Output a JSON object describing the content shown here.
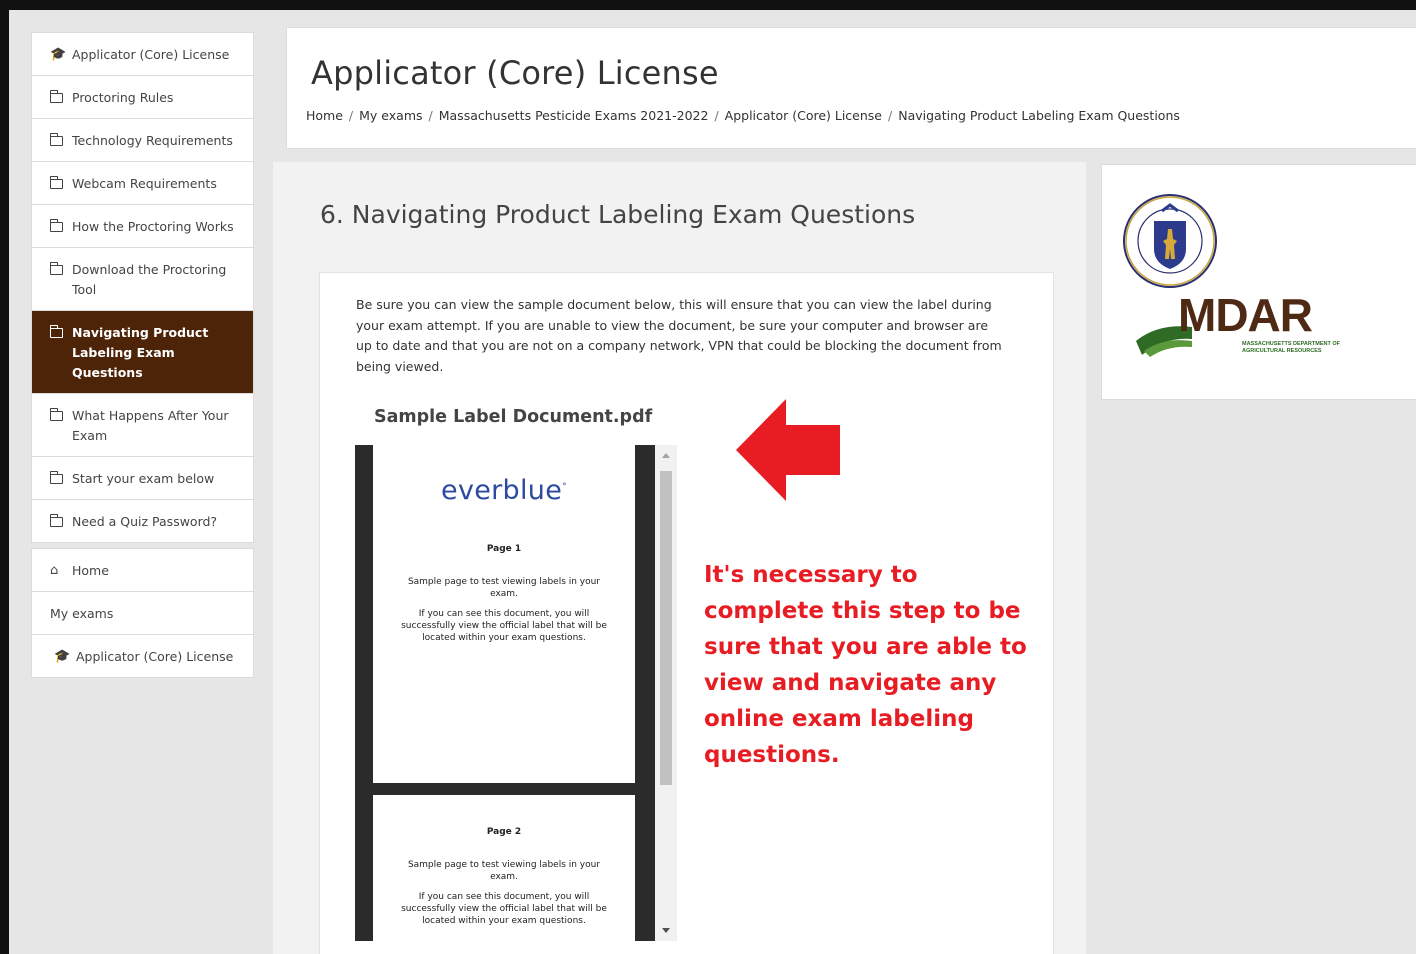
{
  "sidebar": {
    "section_items": [
      {
        "label": "Applicator (Core) License",
        "icon": "graduation-cap-icon"
      },
      {
        "label": "Proctoring Rules",
        "icon": "folder-icon"
      },
      {
        "label": "Technology Requirements",
        "icon": "folder-icon"
      },
      {
        "label": "Webcam Requirements",
        "icon": "folder-icon"
      },
      {
        "label": "How the Proctoring Works",
        "icon": "folder-icon"
      },
      {
        "label": "Download the Proctoring Tool",
        "icon": "folder-icon"
      },
      {
        "label": "Navigating Product Labeling Exam Questions",
        "icon": "folder-icon",
        "active": true
      },
      {
        "label": "What Happens After Your Exam",
        "icon": "folder-icon"
      },
      {
        "label": "Start your exam below",
        "icon": "folder-icon"
      },
      {
        "label": "Need a Quiz Password?",
        "icon": "folder-icon"
      }
    ],
    "nav_items": [
      {
        "label": "Home",
        "icon": "home-icon"
      },
      {
        "label": "My exams"
      },
      {
        "label": "Applicator (Core) License",
        "icon": "graduation-cap-icon"
      }
    ]
  },
  "header": {
    "title": "Applicator (Core) License",
    "breadcrumb": [
      "Home",
      "My exams",
      "Massachusetts Pesticide Exams 2021-2022",
      "Applicator (Core) License",
      "Navigating Product Labeling Exam Questions"
    ]
  },
  "main": {
    "section_title": "6. Navigating Product Labeling Exam Questions",
    "intro": "Be sure you can view the sample document below, this will ensure that you can view the label during your exam attempt. If you are unable to view the document, be sure your computer and browser are up to date and that you are not on a company network, VPN that could be blocking the document from being viewed.",
    "document_title": "Sample Label Document.pdf",
    "pdf": {
      "logo": "everblue",
      "pages": [
        {
          "number": "Page 1",
          "line1": "Sample page to test viewing labels in your exam.",
          "line2": "If you can see this document, you will successfully view the official label that will be located within your exam questions."
        },
        {
          "number": "Page 2",
          "line1": "Sample page to test viewing labels in your exam.",
          "line2": "If you can see this document, you will successfully view the official label that will be located within your exam questions."
        }
      ]
    },
    "annotation": "It's necessary to complete this step to be sure that you are able to view and navigate any online exam labeling questions.",
    "arrow_color": "#e81c23"
  },
  "logo_card": {
    "seal_text": "SIGILLUM REIPUBLICAE MASSACHUSETTENSIS",
    "mdar": "MDAR",
    "mdar_sub": "Massachusetts Department of Agricultural Resources"
  },
  "colors": {
    "active_nav_bg": "#4e2409",
    "mdar_brown": "#4e2a14",
    "mdar_green": "#2f6b25",
    "everblue": "#2d4aa0"
  }
}
